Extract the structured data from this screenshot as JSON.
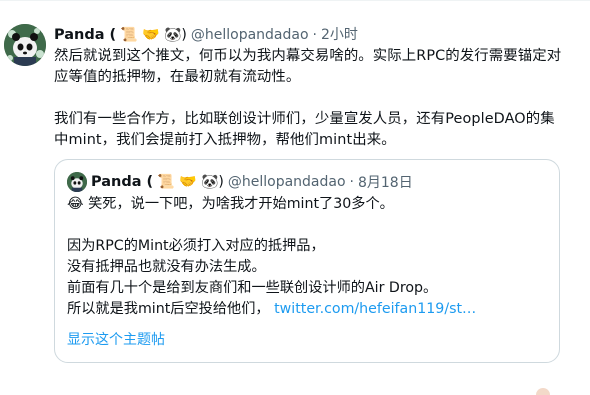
{
  "tweet": {
    "author": {
      "name": "Panda (",
      "emoji_suffix": "📜 🤝 🐼)",
      "handle": "@hellopandadao",
      "dot": "·",
      "time": "2小时"
    },
    "paragraphs": [
      "然后就说到这个推文，何币以为我内幕交易啥的。实际上RPC的发行需要锚定对应等值的抵押物，在最初就有流动性。",
      "我们有一些合作方，比如联创设计师们，少量宣发人员，还有PeopleDAO的集中mint，我们会提前打入抵押物，帮他们mint出来。"
    ],
    "quote": {
      "author": {
        "name": "Panda (",
        "emoji_suffix": "📜 🤝 🐼)",
        "handle": "@hellopandadao",
        "dot": "·",
        "date": "8月18日"
      },
      "lines": [
        "😂 笑死，说一下吧，为啥我才开始mint了30多个。",
        "",
        "因为RPC的Mint必须打入对应的抵押品，",
        "没有抵押品也就没有办法生成。",
        "前面有几十个是给到友商们和一些联创设计师的Air Drop。"
      ],
      "last_line_text": "所以就是我mint后空投给他们，",
      "last_line_link": "twitter.com/hefeifan119/st…",
      "show_thread": "显示这个主题帖"
    }
  }
}
